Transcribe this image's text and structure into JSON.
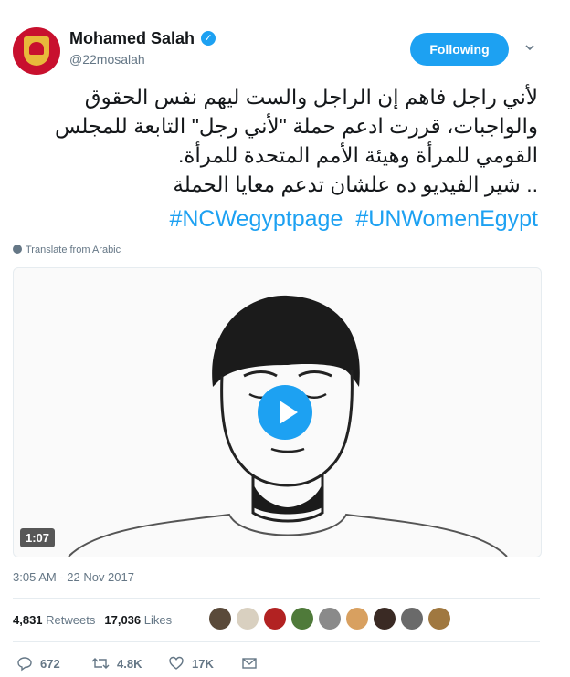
{
  "user": {
    "name": "Mohamed Salah",
    "handle": "@22mosalah",
    "follow_label": "Following"
  },
  "tweet": {
    "text_lines": [
      "لأني راجل فاهم إن الراجل والست ليهم نفس الحقوق",
      "والواجبات، قررت ادعم حملة \"لأني رجل\" التابعة للمجلس",
      "القومي للمرأة وهيئة الأمم المتحدة للمرأة.",
      ".. شير الفيديو ده علشان تدعم معايا الحملة"
    ],
    "hashtags": [
      "#NCWegyptpage",
      "#UNWomenEgypt"
    ],
    "translate_label": "Translate from Arabic"
  },
  "media": {
    "duration": "1:07"
  },
  "meta": {
    "timestamp": "3:05 AM - 22 Nov 2017"
  },
  "stats": {
    "retweets_count": "4,831",
    "retweets_label": "Retweets",
    "likes_count": "17,036",
    "likes_label": "Likes"
  },
  "actions": {
    "replies": "672",
    "retweets": "4.8K",
    "likes": "17K"
  },
  "colors": {
    "accent": "#1da1f2",
    "muted": "#657786"
  }
}
